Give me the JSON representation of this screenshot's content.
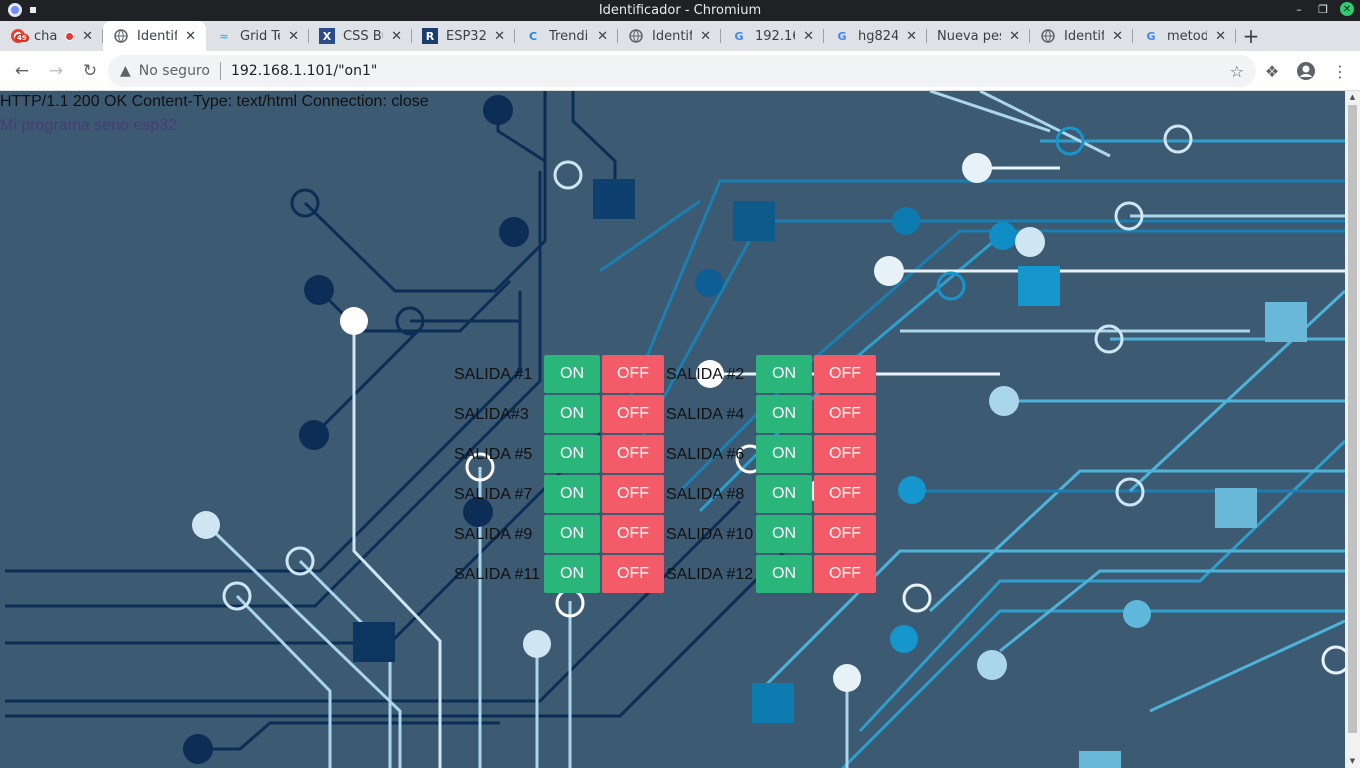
{
  "window": {
    "title": "Identificador - Chromium"
  },
  "tabs": [
    {
      "title": "cha",
      "favicon": "gmail-icon",
      "badge": "49"
    },
    {
      "title": "Identifi",
      "favicon": "globe-icon",
      "active": true
    },
    {
      "title": "Grid Te",
      "favicon": "tailwind-icon"
    },
    {
      "title": "CSS Bu",
      "favicon": "x-icon"
    },
    {
      "title": "ESP32 S",
      "favicon": "r-icon"
    },
    {
      "title": "Trendi",
      "favicon": "c-icon"
    },
    {
      "title": "Identif",
      "favicon": "globe-icon"
    },
    {
      "title": "192.16",
      "favicon": "google-icon"
    },
    {
      "title": "hg824",
      "favicon": "google-icon"
    },
    {
      "title": "Nueva pes",
      "favicon": ""
    },
    {
      "title": "Identif",
      "favicon": "globe-icon"
    },
    {
      "title": "metod",
      "favicon": "google-icon"
    }
  ],
  "toolbar": {
    "security_label": "No seguro",
    "url": "192.168.1.101/\"on1\""
  },
  "page": {
    "http_header": "HTTP/1.1 200 OK Content-Type: text/html Connection: close",
    "program_text": "Mi programa serio esp32",
    "on_label": "ON",
    "off_label": "OFF",
    "outputs": [
      "SALIDA #1",
      "SALIDA #2",
      "SALIDA#3",
      "SALIDA #4",
      "SALIDA #5",
      "SALIDA #6",
      "SALIDA #7",
      "SALIDA #8",
      "SALIDA #9",
      "SALIDA #10",
      "SALIDA #11",
      "SALIDA #12"
    ]
  },
  "colors": {
    "on": "#2ab57a",
    "off": "#f45b69",
    "background": "#3d5a73"
  }
}
